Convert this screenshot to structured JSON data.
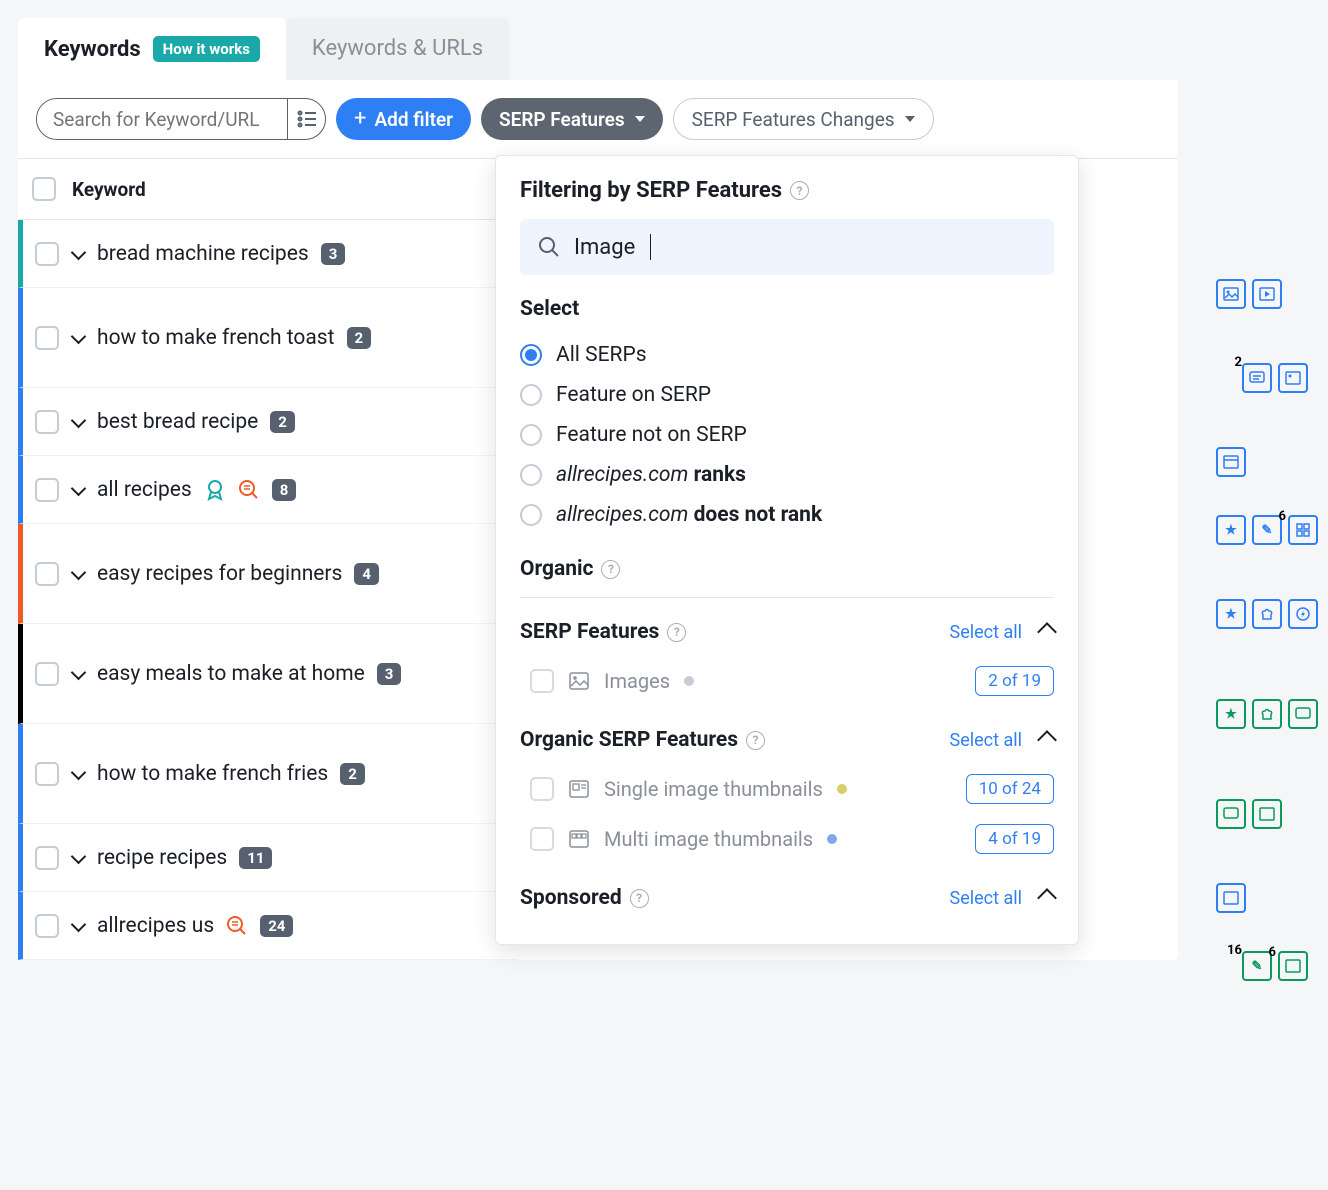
{
  "tabs": {
    "active": "Keywords",
    "how_it_works": "How it works",
    "secondary": "Keywords & URLs"
  },
  "toolbar": {
    "search_placeholder": "Search for Keyword/URL",
    "add_filter": "Add filter",
    "serp_features": "SERP Features",
    "serp_changes": "SERP Features Changes"
  },
  "table": {
    "header": "Keyword",
    "rows": [
      {
        "text": "bread machine recipes",
        "count": "3",
        "color": "teal",
        "tall": false
      },
      {
        "text": "how to make french toast",
        "count": "2",
        "color": "blue",
        "tall": true
      },
      {
        "text": "best bread recipe",
        "count": "2",
        "color": "blue",
        "tall": false
      },
      {
        "text": "all recipes",
        "count": "8",
        "color": "blue",
        "tall": false,
        "extra_icons": true
      },
      {
        "text": "easy recipes for beginners",
        "count": "4",
        "color": "orange",
        "tall": true
      },
      {
        "text": "easy meals to make at home",
        "count": "3",
        "color": "black",
        "tall": true
      },
      {
        "text": "how to make french fries",
        "count": "2",
        "color": "blue",
        "tall": true
      },
      {
        "text": "recipe recipes",
        "count": "11",
        "color": "blue",
        "tall": false
      },
      {
        "text": "allrecipes us",
        "count": "24",
        "color": "blue",
        "tall": false,
        "extra_icon_single": true
      }
    ]
  },
  "dropdown": {
    "title": "Filtering by SERP Features",
    "search_value": "Image",
    "select_label": "Select",
    "domain": "allrecipes.com",
    "radios": {
      "all": "All SERPs",
      "on": "Feature on SERP",
      "not_on": "Feature not on SERP",
      "ranks_suffix": "ranks",
      "not_rank_suffix": "does not rank"
    },
    "organic_label": "Organic",
    "select_all": "Select all",
    "sections": {
      "serp_features": {
        "title": "SERP Features",
        "items": [
          {
            "label": "Images",
            "count": "2 of 19",
            "dot": "grey"
          }
        ]
      },
      "organic_serp": {
        "title": "Organic SERP Features",
        "items": [
          {
            "label": "Single image thumbnails",
            "count": "10 of 24",
            "dot": "yellow"
          },
          {
            "label": "Multi image thumbnails",
            "count": "4 of 19",
            "dot": "blue"
          }
        ]
      },
      "sponsored": {
        "title": "Sponsored"
      }
    }
  },
  "side_badges": {
    "r1_sup": "2",
    "r4_sup": "6",
    "r9a": "16",
    "r9b": "6"
  }
}
